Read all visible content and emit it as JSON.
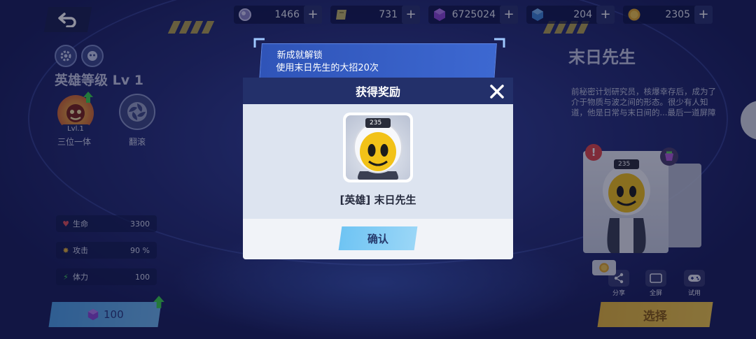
{
  "currencies": [
    {
      "icon": "orb-icon",
      "value": "1466"
    },
    {
      "icon": "ticket-icon",
      "value": "731"
    },
    {
      "icon": "purple-gem-icon",
      "value": "6725024"
    },
    {
      "icon": "blue-gem-icon",
      "value": "204"
    },
    {
      "icon": "gold-coin-icon",
      "value": "2305"
    }
  ],
  "plus_label": "+",
  "hero": {
    "level": "英雄等级 Lv 1",
    "skill1_label": "三位一体",
    "skill1_badge": "Lvl.1",
    "skill2_label": "翻滚",
    "stats": [
      {
        "name": "生命",
        "value": "3300"
      },
      {
        "name": "攻击",
        "value": "90 %"
      },
      {
        "name": "体力",
        "value": "100"
      }
    ],
    "buy_price": "100"
  },
  "profile": {
    "name": "末日先生",
    "description": "前秘密计划研究员，核爆幸存后，成为了介于物质与波之间的形态。很少有人知道，他是日常与末日间的...最后一道屏障",
    "card_tag": "235",
    "tools": [
      "分享",
      "全屏",
      "试用"
    ],
    "select_label": "选择"
  },
  "achievement": {
    "title": "新成就解锁",
    "detail": "使用末日先生的大招20次"
  },
  "modal": {
    "title": "获得奖励",
    "reward_name": "[英雄] 末日先生",
    "reward_tag": "235",
    "confirm_label": "确认"
  },
  "colors": {
    "background": "#27307a",
    "accent_blue": "#6fc4f3",
    "accent_gold": "#f2c849",
    "toast": "#3d68d1"
  }
}
